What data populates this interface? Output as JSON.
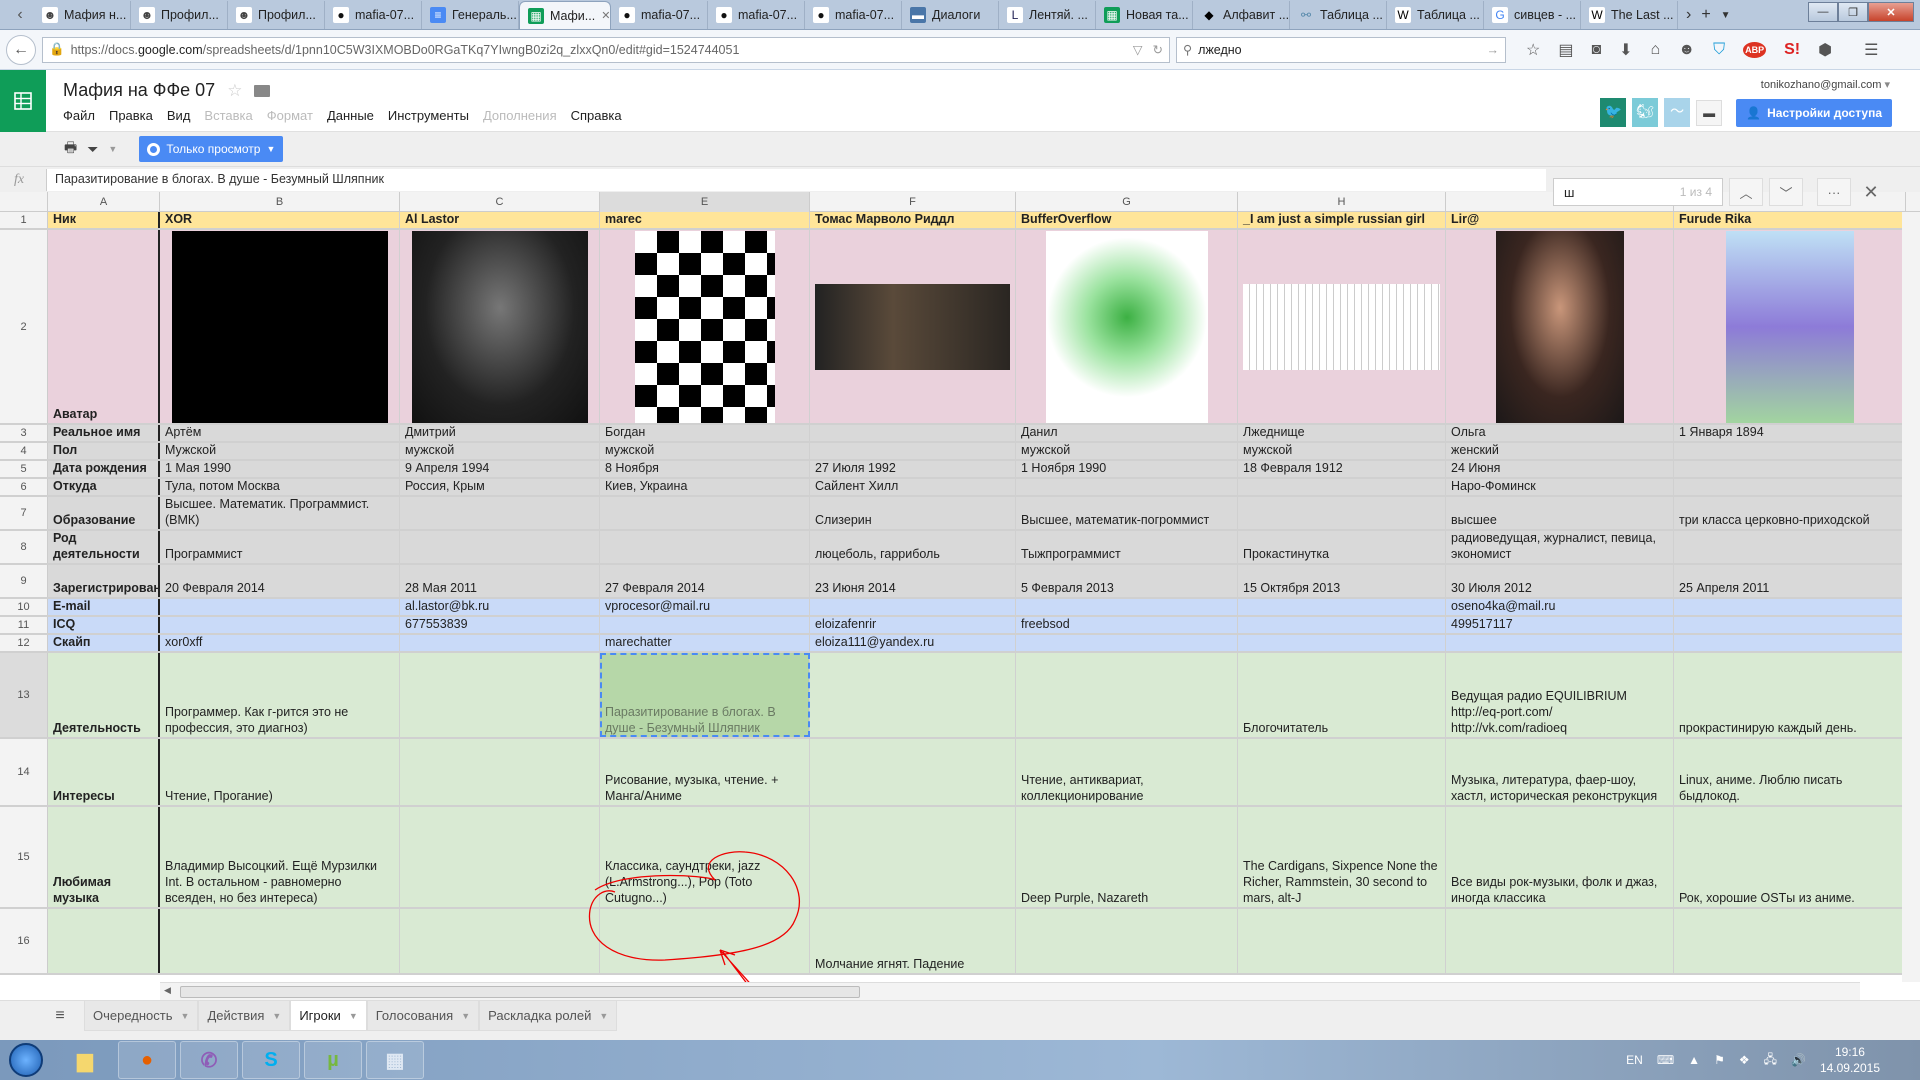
{
  "browser": {
    "tabs": [
      {
        "label": "Мафия н...",
        "icon": "mafia-avatar-icon"
      },
      {
        "label": "Профил...",
        "icon": "mafia-avatar-icon"
      },
      {
        "label": "Профил...",
        "icon": "mafia-avatar-icon"
      },
      {
        "label": "mafia-07...",
        "icon": "github-icon"
      },
      {
        "label": "Генераль...",
        "icon": "google-docs-icon"
      },
      {
        "label": "Мафи...",
        "icon": "google-sheets-icon",
        "active": true
      },
      {
        "label": "mafia-07...",
        "icon": "github-icon"
      },
      {
        "label": "mafia-07...",
        "icon": "github-icon"
      },
      {
        "label": "mafia-07...",
        "icon": "github-icon"
      },
      {
        "label": "Диалоги",
        "icon": "vk-dialogs-icon"
      },
      {
        "label": "Лентяй. ...",
        "icon": "lib-ru-icon"
      },
      {
        "label": "Новая та...",
        "icon": "google-sheets-icon"
      },
      {
        "label": "Алфавит ...",
        "icon": "diamond-icon"
      },
      {
        "label": "Таблица ...",
        "icon": "link-icon"
      },
      {
        "label": "Таблица ...",
        "icon": "wikipedia-icon"
      },
      {
        "label": "сивцев - ...",
        "icon": "google-icon"
      },
      {
        "label": "The Last ...",
        "icon": "wikipedia-icon"
      }
    ],
    "url_prefix": "https://docs.",
    "url_host": "google.com",
    "url_path": "/spreadsheets/d/1pnn10C5W3IXMOBDo0RGaTKq7YIwngB0zi2q_zlxxQn0/edit#gid=1524744051",
    "search_value": "лжедно"
  },
  "app": {
    "title": "Мафия на ФФе 07",
    "menu": [
      {
        "label": "Файл",
        "disabled": false
      },
      {
        "label": "Правка",
        "disabled": false
      },
      {
        "label": "Вид",
        "disabled": false
      },
      {
        "label": "Вставка",
        "disabled": true
      },
      {
        "label": "Формат",
        "disabled": true
      },
      {
        "label": "Данные",
        "disabled": false
      },
      {
        "label": "Инструменты",
        "disabled": false
      },
      {
        "label": "Дополнения",
        "disabled": true
      },
      {
        "label": "Справка",
        "disabled": false
      }
    ],
    "user_email": "tonikozhano@gmail.com",
    "share_label": "Настройки доступа",
    "view_only_label": "Только просмотр",
    "formula_value": "Паразитирование в блогах. В душе - Безумный Шляпник",
    "find": {
      "value": "ш",
      "count": "1 из 4"
    }
  },
  "sheet": {
    "columns": [
      "A",
      "B",
      "C",
      "E",
      "F",
      "G",
      "H",
      "I",
      "J"
    ],
    "selected_column": "E",
    "rows": [
      {
        "num": "1",
        "style": "yellow",
        "cells": [
          "Ник",
          "XOR",
          "Al Lastor",
          "marec",
          "Томас Марволо Риддл",
          "BufferOverflow",
          "_I am just a simple russian girl",
          "Lir@",
          "Furude Rika"
        ]
      },
      {
        "num": "2",
        "style": "pink",
        "cells": [
          "Аватар",
          "",
          "",
          "",
          "",
          "",
          "",
          "",
          ""
        ]
      },
      {
        "num": "3",
        "style": "grey",
        "cells": [
          "Реальное имя",
          "Артём",
          "Дмитрий",
          "Богдан",
          "",
          "Данил",
          "Лжеднище",
          "Ольга",
          "1 Января 1894"
        ]
      },
      {
        "num": "4",
        "style": "grey",
        "cells": [
          "Пол",
          "Мужской",
          "мужской",
          "мужской",
          "",
          "мужской",
          "мужской",
          "женский",
          ""
        ]
      },
      {
        "num": "5",
        "style": "grey",
        "cells": [
          "Дата рождения",
          "1 Мая 1990",
          "9 Апреля 1994",
          "8 Ноября",
          "27 Июля 1992",
          "1 Ноября 1990",
          "18 Февраля 1912",
          "24 Июня",
          ""
        ]
      },
      {
        "num": "6",
        "style": "grey",
        "cells": [
          "Откуда",
          "Тула, потом Москва",
          "Россия, Крым",
          "Киев, Украина",
          "Сайлент Хилл",
          "",
          "",
          "Наро-Фоминск",
          ""
        ]
      },
      {
        "num": "7",
        "style": "grey",
        "cells": [
          "Образование",
          "Высшее. Математик. Программист. (ВМК)",
          "",
          "",
          "Слизерин",
          "Высшее, математик-погроммист",
          "",
          "высшее",
          "три класса церковно-приходской"
        ]
      },
      {
        "num": "8",
        "style": "grey",
        "cells": [
          "Род деятельности",
          "Программист",
          "",
          "",
          "люцеболь, гарриболь",
          "Тыжпрограммист",
          "Прокастинутка",
          "радиоведущая, журналист, певица, экономист",
          ""
        ]
      },
      {
        "num": "9",
        "style": "grey",
        "cells": [
          "Зарегистрирован",
          "20 Февраля 2014",
          "28 Мая 2011",
          "27 Февраля 2014",
          "23 Июня 2014",
          "5 Февраля 2013",
          "15 Октября 2013",
          "30 Июля 2012",
          "25 Апреля 2011"
        ]
      },
      {
        "num": "10",
        "style": "blue",
        "cells": [
          "E-mail",
          "",
          "al.lastor@bk.ru",
          "vprocesor@mail.ru",
          "",
          "",
          "",
          "oseno4ka@mail.ru",
          ""
        ]
      },
      {
        "num": "11",
        "style": "blue",
        "cells": [
          "ICQ",
          "",
          "677553839",
          "",
          "eloizafenrir",
          "freebsod",
          "",
          "499517117",
          ""
        ]
      },
      {
        "num": "12",
        "style": "blue",
        "cells": [
          "Скайп",
          "xor0xff",
          "",
          "marechatter",
          "eloiza111@yandex.ru",
          "",
          "",
          "",
          ""
        ]
      },
      {
        "num": "13",
        "style": "green",
        "cells": [
          "Деятельность",
          "Программер. Как г-рится это не профессия, это диагноз)",
          "",
          "Паразитирование в блогах. В душе - Безумный Шляпник",
          "",
          "",
          "Блогочитатель",
          "Ведущая радио EQUILIBRIUM http://eq-port.com/ http://vk.com/radioeq",
          "прокрастинирую каждый день."
        ]
      },
      {
        "num": "14",
        "style": "green",
        "cells": [
          "Интересы",
          "Чтение, Прогание)",
          "",
          "Рисование, музыка, чтение. + Манга/Аниме",
          "",
          "Чтение, антиквариат, коллекционирование",
          "",
          "Музыка, литература, фаер-шоу, хастл, историческая реконструкция",
          "Linux, аниме. Люблю писать быдлокод."
        ]
      },
      {
        "num": "15",
        "style": "green",
        "cells": [
          "Любимая музыка",
          "Владимир Высоцкий. Ещё Мурзилки Int. В остальном - равномерно всеяден, но без интереса)",
          "",
          "Классика, саундтреки, jazz (L.Armstrong...), Pop (Toto Cutugno...)",
          "",
          "Deep Purple, Nazareth",
          "The Cardigans, Sixpence None the Richer, Rammstein, 30 second to mars, alt-J",
          "Все виды рок-музыки, фолк и джаз, иногда классика",
          "Рок, хорошие OSTы из аниме."
        ]
      },
      {
        "num": "16",
        "style": "green",
        "cells": [
          "",
          "",
          "",
          "",
          "Молчание ягнят. Падение",
          "",
          "",
          "",
          ""
        ]
      }
    ]
  },
  "sheet_tabs": [
    {
      "label": "Очередность",
      "active": false
    },
    {
      "label": "Действия",
      "active": false
    },
    {
      "label": "Игроки",
      "active": true
    },
    {
      "label": "Голосования",
      "active": false
    },
    {
      "label": "Раскладка ролей",
      "active": false
    }
  ],
  "taskbar": {
    "apps": [
      "file-explorer",
      "firefox",
      "viber",
      "skype",
      "utorrent",
      "calculator"
    ],
    "language": "EN",
    "time": "19:16",
    "date": "14.09.2015"
  }
}
